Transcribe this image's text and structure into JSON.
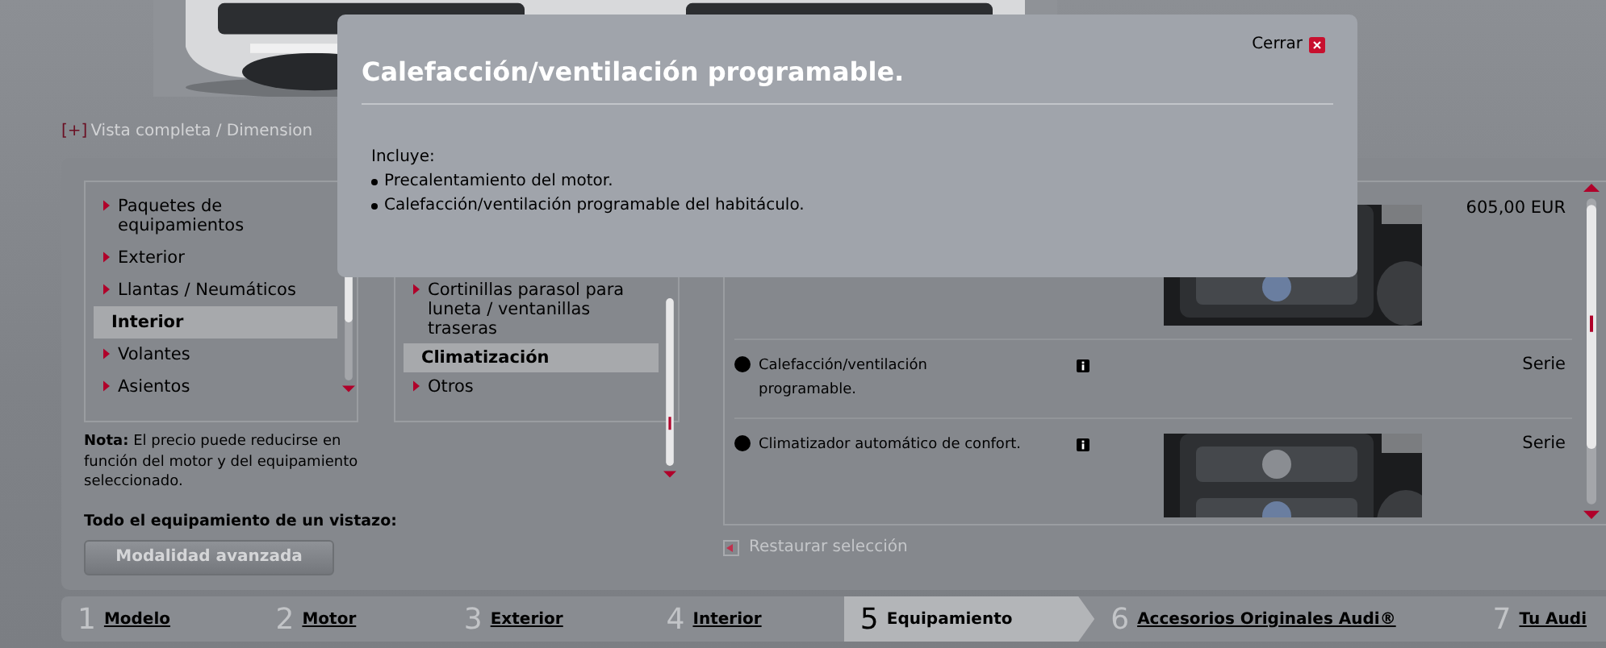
{
  "view_link": {
    "icon": "[+]",
    "label": "Vista completa / Dimension"
  },
  "categories": [
    {
      "label": "Paquetes de equipamientos",
      "selected": false
    },
    {
      "label": "Exterior",
      "selected": false
    },
    {
      "label": "Llantas / Neumáticos",
      "selected": false
    },
    {
      "label": "Interior",
      "selected": true
    },
    {
      "label": "Volantes",
      "selected": false
    },
    {
      "label": "Asientos",
      "selected": false
    }
  ],
  "subcategories": [
    {
      "label": "Cortinillas parasol para luneta / ventanillas traseras",
      "selected": false
    },
    {
      "label": "Climatización",
      "selected": true
    },
    {
      "label": "Otros",
      "selected": false
    }
  ],
  "note": "**Nota:** El precio puede reducirse en función del motor y del equipamiento seleccionado.",
  "overview_label": "Todo el equipamiento de un vistazo:",
  "advanced_button": "Modalidad avanzada",
  "options": [
    {
      "price": "605,00 EUR",
      "has_image": true
    },
    {
      "name": "Calefacción/ventilación programable.",
      "price": "Serie",
      "has_image": false
    },
    {
      "name": "Climatizador automático de confort.",
      "price": "Serie",
      "has_image": true
    }
  ],
  "restore": "Restaurar selección",
  "steps": [
    {
      "number": "1",
      "label": "Modelo",
      "selected": false
    },
    {
      "number": "2",
      "label": "Motor",
      "selected": false
    },
    {
      "number": "3",
      "label": "Exterior",
      "selected": false
    },
    {
      "number": "4",
      "label": "Interior",
      "selected": false
    },
    {
      "number": "5",
      "label": "Equipamiento",
      "selected": true
    },
    {
      "number": "6",
      "label": "Accesorios Originales Audi®",
      "selected": false
    },
    {
      "number": "7",
      "label": "Tu Audi",
      "selected": false
    }
  ],
  "modal": {
    "title": "Calefacción/ventilación programable.",
    "close": "Cerrar",
    "intro": "Incluye:",
    "bullets": [
      "Precalentamiento del motor.",
      "Calefacción/ventilación programable del habitáculo."
    ]
  }
}
